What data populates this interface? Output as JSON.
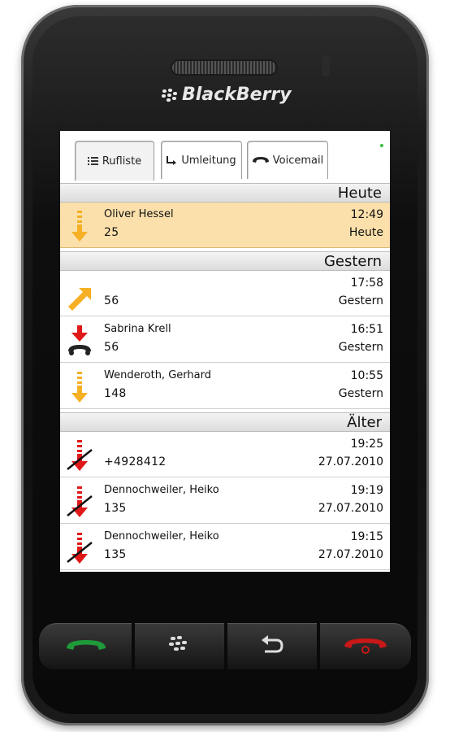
{
  "device": {
    "brand": "BlackBerry"
  },
  "tabs": [
    {
      "label": "Rufliste",
      "icon": "list-icon"
    },
    {
      "label": "Umleitung",
      "icon": "forward-icon"
    },
    {
      "label": "Voicemail",
      "icon": "voicemail-icon"
    }
  ],
  "sections": {
    "today": "Heute",
    "yesterday": "Gestern",
    "older": "Älter"
  },
  "calls": [
    {
      "name": "Oliver Hessel",
      "number": "25",
      "time": "12:49",
      "date": "Heute",
      "type": "incoming-answered",
      "selected": true
    },
    {
      "name": "",
      "number": "56",
      "time": "17:58",
      "date": "Gestern",
      "type": "outgoing"
    },
    {
      "name": "Sabrina Krell",
      "number": "56",
      "time": "16:51",
      "date": "Gestern",
      "type": "incoming-hangup"
    },
    {
      "name": "Wenderoth, Gerhard",
      "number": "148",
      "time": "10:55",
      "date": "Gestern",
      "type": "incoming-answered"
    },
    {
      "name": "",
      "number": "+4928412",
      "time": "19:25",
      "date": "27.07.2010",
      "type": "missed"
    },
    {
      "name": "Dennochweiler, Heiko",
      "number": "135",
      "time": "19:19",
      "date": "27.07.2010",
      "type": "missed"
    },
    {
      "name": "Dennochweiler, Heiko",
      "number": "135",
      "time": "19:15",
      "date": "27.07.2010",
      "type": "missed"
    }
  ],
  "colors": {
    "selected_row": "#fbe0ab",
    "incoming": "#f5b025",
    "missed": "#e01818",
    "call_green": "#1f9a3a",
    "end_red": "#c81818"
  }
}
